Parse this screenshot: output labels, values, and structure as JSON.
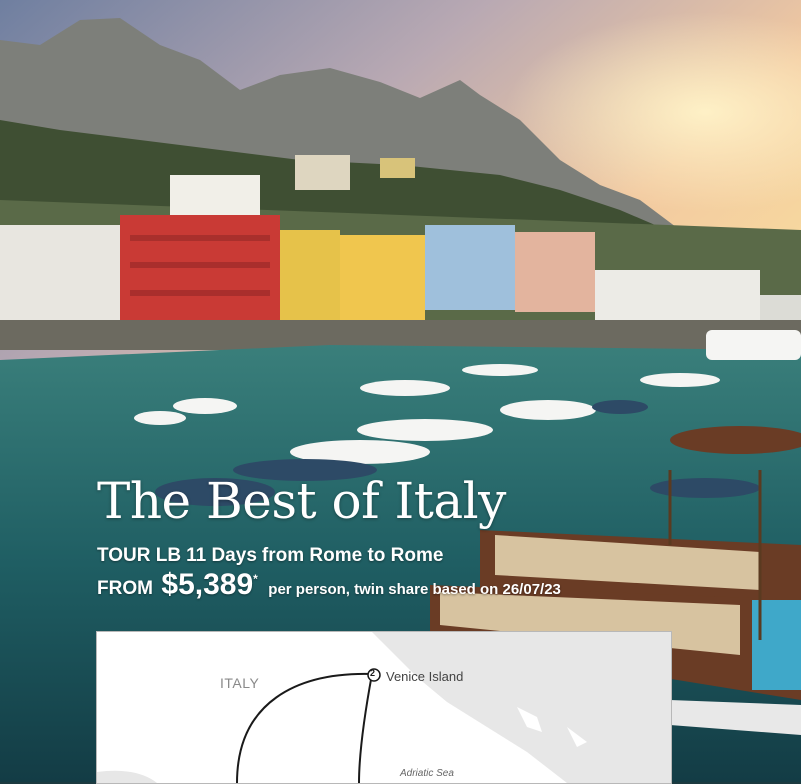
{
  "tour": {
    "title": "The Best of Italy",
    "code_label": "TOUR LB",
    "duration": "11 Days",
    "route": "from Rome to Rome",
    "from_label": "FROM",
    "price": "$5,389",
    "price_asterisk": "*",
    "price_note": "per person, twin share based on 26/07/23"
  },
  "map": {
    "country_label": "ITALY",
    "stop_number": "2",
    "stop_name": "Venice Island",
    "sea_label": "Adriatic Sea"
  },
  "colors": {
    "text_on_photo": "#ffffff",
    "map_background": "#ffffff",
    "map_land": "#e7e7e7",
    "route_line": "#1a1a1a"
  }
}
